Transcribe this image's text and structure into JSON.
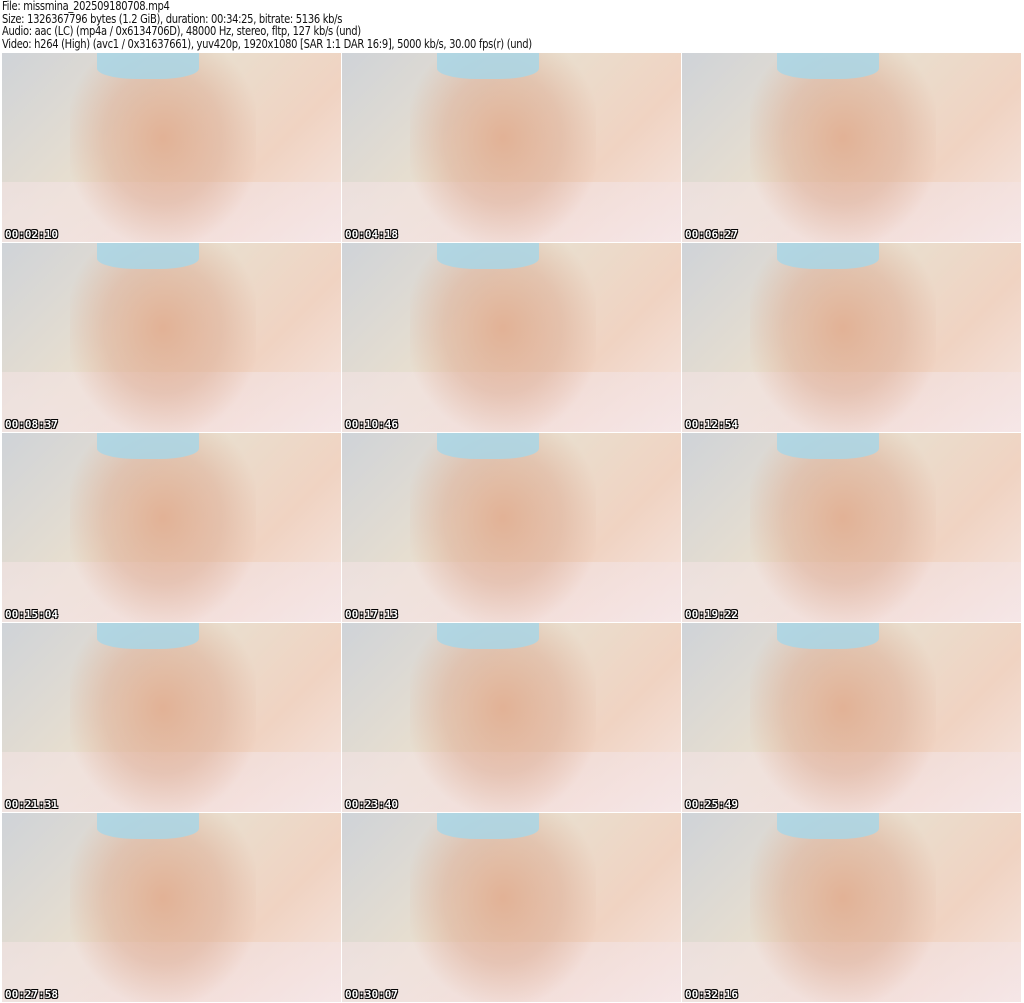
{
  "header": {
    "file": "File: missmina_202509180708.mp4",
    "size": "Size: 1326367796 bytes (1.2 GiB), duration: 00:34:25, bitrate: 5136 kb/s",
    "audio": "Audio: aac (LC) (mp4a / 0x6134706D), 48000 Hz, stereo, fltp, 127 kb/s (und)",
    "video": "Video: h264 (High) (avc1 / 0x31637661), yuv420p, 1920x1080 [SAR 1:1 DAR 16:9], 5000 kb/s, 30.00 fps(r) (und)"
  },
  "thumbnails": [
    {
      "timestamp": "00:02:10"
    },
    {
      "timestamp": "00:04:18"
    },
    {
      "timestamp": "00:06:27"
    },
    {
      "timestamp": "00:08:37"
    },
    {
      "timestamp": "00:10:46"
    },
    {
      "timestamp": "00:12:54"
    },
    {
      "timestamp": "00:15:04"
    },
    {
      "timestamp": "00:17:13"
    },
    {
      "timestamp": "00:19:22"
    },
    {
      "timestamp": "00:21:31"
    },
    {
      "timestamp": "00:23:40"
    },
    {
      "timestamp": "00:25:49"
    },
    {
      "timestamp": "00:27:58"
    },
    {
      "timestamp": "00:30:07"
    },
    {
      "timestamp": "00:32:16"
    }
  ]
}
